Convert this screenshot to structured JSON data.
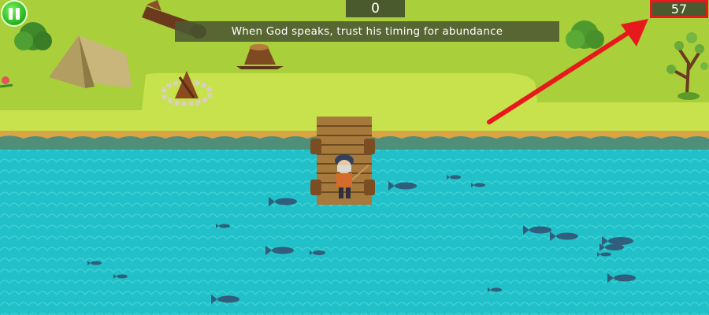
{
  "hud": {
    "score": "0",
    "timer": "57",
    "message": "When God speaks, trust his timing for abundance",
    "pause_icon": "pause-icon"
  },
  "annotation": {
    "highlight_color": "#e8191d",
    "arrow_target": "timer"
  },
  "colors": {
    "grass": "#a9cf3b",
    "grass_light": "#c6e04f",
    "water": "#22c0c8",
    "pause_green": "#23b31f"
  }
}
